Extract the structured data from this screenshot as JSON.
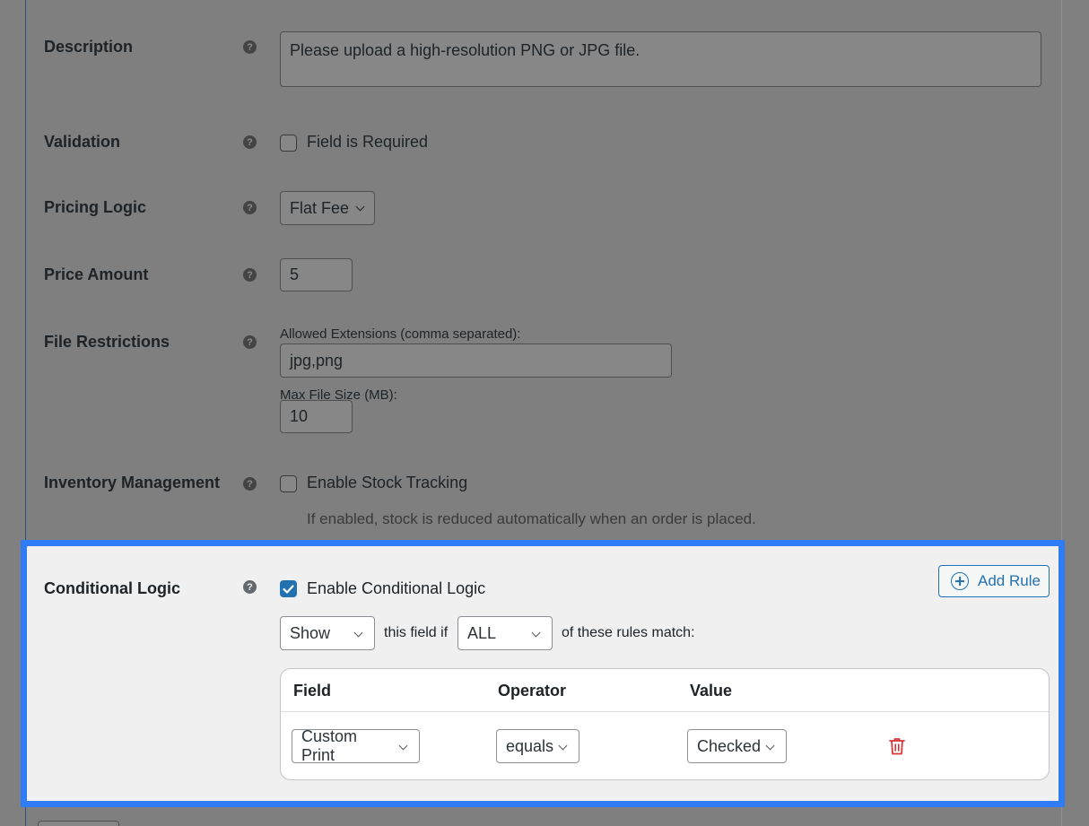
{
  "fields": {
    "description": {
      "label": "Description",
      "value": "Please upload a high-resolution PNG or JPG file."
    },
    "validation": {
      "label": "Validation",
      "checkbox_label": "Field is Required",
      "checked": false
    },
    "pricing_logic": {
      "label": "Pricing Logic",
      "selected": "Flat Fee"
    },
    "price_amount": {
      "label": "Price Amount",
      "value": "5"
    },
    "file_restrictions": {
      "label": "File Restrictions",
      "extensions_label": "Allowed Extensions (comma separated):",
      "extensions_value": "jpg,png",
      "max_size_label": "Max File Size (MB):",
      "max_size_value": "10"
    },
    "inventory": {
      "label": "Inventory Management",
      "checkbox_label": "Enable Stock Tracking",
      "checked": false,
      "hint": "If enabled, stock is reduced automatically when an order is placed."
    }
  },
  "help_glyph": "?",
  "conditional_logic": {
    "label": "Conditional Logic",
    "enable_label": "Enable Conditional Logic",
    "enabled": true,
    "add_rule_label": "Add Rule",
    "action_selected": "Show",
    "this_field_if": "this field if",
    "match_selected": "ALL",
    "of_rules_match": "of these rules match:",
    "columns": [
      "Field",
      "Operator",
      "Value"
    ],
    "rules": [
      {
        "field": "Custom Print",
        "operator": "equals",
        "value": "Checked"
      }
    ]
  },
  "colors": {
    "highlight_border": "#2f7cf6",
    "primary": "#2271b1",
    "delete": "#d63638"
  },
  "icons": {
    "help": "help-icon",
    "check": "checkmark-icon",
    "add": "plus-circle-icon",
    "delete": "trash-icon",
    "dropdown": "chevron-down-icon"
  }
}
